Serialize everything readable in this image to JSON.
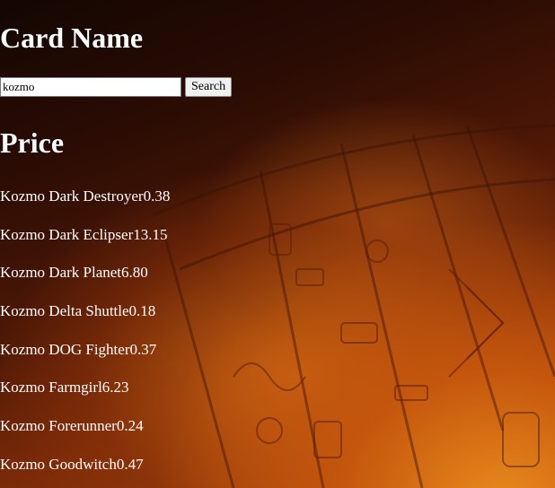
{
  "card_name_heading": "Card Name",
  "search": {
    "value": "kozmo",
    "button_label": "Search"
  },
  "price_heading": "Price",
  "results": [
    {
      "name": "Kozmo Dark Destroyer",
      "price": "0.38"
    },
    {
      "name": "Kozmo Dark Eclipser",
      "price": "13.15"
    },
    {
      "name": "Kozmo Dark Planet",
      "price": "6.80"
    },
    {
      "name": "Kozmo Delta Shuttle",
      "price": "0.18"
    },
    {
      "name": "Kozmo DOG Fighter",
      "price": "0.37"
    },
    {
      "name": "Kozmo Farmgirl",
      "price": "6.23"
    },
    {
      "name": "Kozmo Forerunner",
      "price": "0.24"
    },
    {
      "name": "Kozmo Goodwitch",
      "price": "0.47"
    }
  ],
  "colors": {
    "text": "#ffffff",
    "background_dark": "#140602",
    "background_glow": "#e88a1c"
  }
}
